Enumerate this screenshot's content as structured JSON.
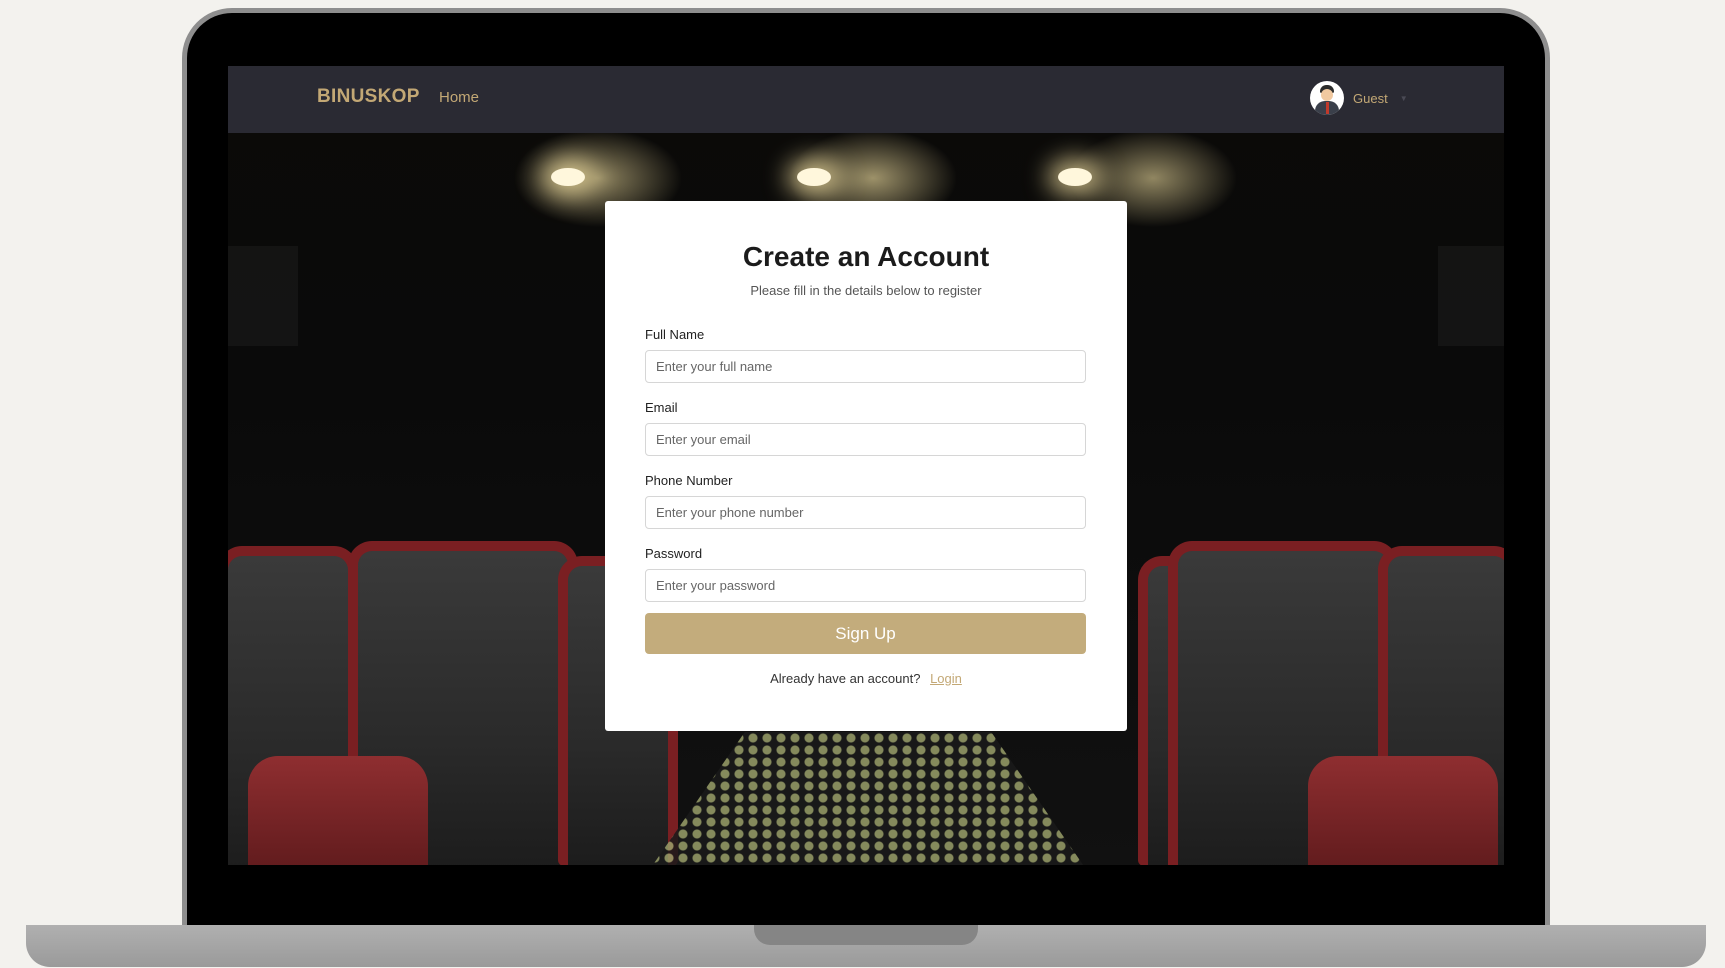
{
  "navbar": {
    "brand": "BINUSKOP",
    "home_link": "Home",
    "user_label": "Guest",
    "user_avatar_icon": "user-avatar-icon",
    "dropdown_icon": "caret-down-icon"
  },
  "form": {
    "title": "Create an Account",
    "subtitle": "Please fill in the details below to register",
    "full_name": {
      "label": "Full Name",
      "placeholder": "Enter your full name",
      "value": ""
    },
    "email": {
      "label": "Email",
      "placeholder": "Enter your email",
      "value": ""
    },
    "phone": {
      "label": "Phone Number",
      "placeholder": "Enter your phone number",
      "value": ""
    },
    "password": {
      "label": "Password",
      "placeholder": "Enter your password",
      "value": ""
    },
    "submit_label": "Sign Up",
    "footer_text": "Already have an account?",
    "login_link": "Login"
  },
  "colors": {
    "accent": "#c3a875",
    "button": "#c3ac7c",
    "navbar_bg": "#2a2a33",
    "card_bg": "#ffffff",
    "seat_red": "#7a1f22"
  }
}
